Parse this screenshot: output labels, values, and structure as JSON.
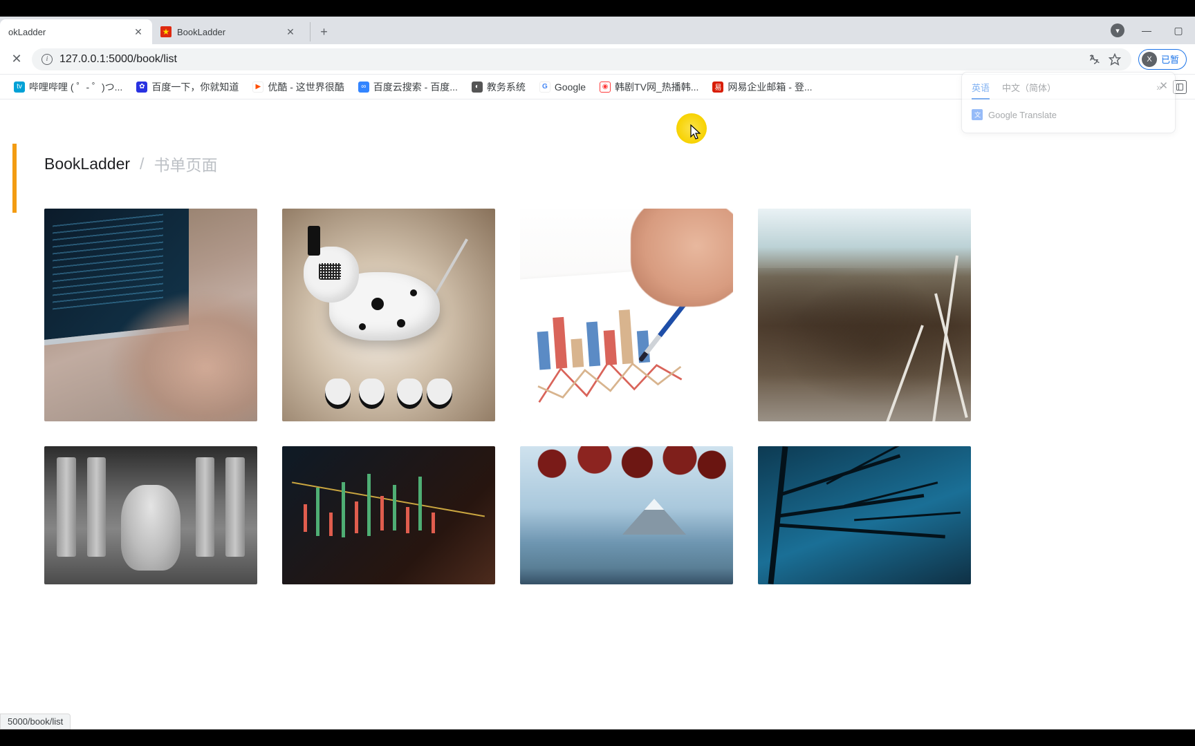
{
  "browser": {
    "tabs": [
      {
        "title": "okLadder",
        "active": true,
        "favicon": "none"
      },
      {
        "title": "BookLadder",
        "active": false,
        "favicon": "red"
      }
    ],
    "url": "127.0.0.1:5000/book/list",
    "translate_icon": "translate-icon",
    "star_icon": "star-icon",
    "user_label": "已暂",
    "user_initial": "X",
    "profile_initial": "▾"
  },
  "bookmarks": [
    {
      "label": "哔哩哔哩 ( ゜- ゜)つ...",
      "color": "#00a1d6"
    },
    {
      "label": "百度一下，你就知道",
      "color": "#2932e1"
    },
    {
      "label": "优酷 - 这世界很酷",
      "color": "#ff4e00"
    },
    {
      "label": "百度云搜索 - 百度...",
      "color": "#3385ff"
    },
    {
      "label": "教务系统",
      "color": "#555"
    },
    {
      "label": "Google",
      "color": "#4285f4",
      "glyph": "G"
    },
    {
      "label": "韩剧TV网_热播韩...",
      "color": "#ff3a3a"
    },
    {
      "label": "网易企业邮箱 - 登...",
      "color": "#d81e06"
    }
  ],
  "translate_popup": {
    "tab_source": "英语",
    "tab_target": "中文（简体）",
    "body": "Google Translate"
  },
  "page": {
    "breadcrumb_root": "BookLadder",
    "breadcrumb_sep": "/",
    "breadcrumb_current": "书单页面"
  },
  "status_text": "5000/book/list",
  "cards": [
    {
      "name": "card-laptop-coding"
    },
    {
      "name": "card-robot-dog"
    },
    {
      "name": "card-pen-chart"
    },
    {
      "name": "card-mountain-road"
    },
    {
      "name": "card-statue"
    },
    {
      "name": "card-candlestick"
    },
    {
      "name": "card-fuji"
    },
    {
      "name": "card-dark-tree"
    }
  ]
}
